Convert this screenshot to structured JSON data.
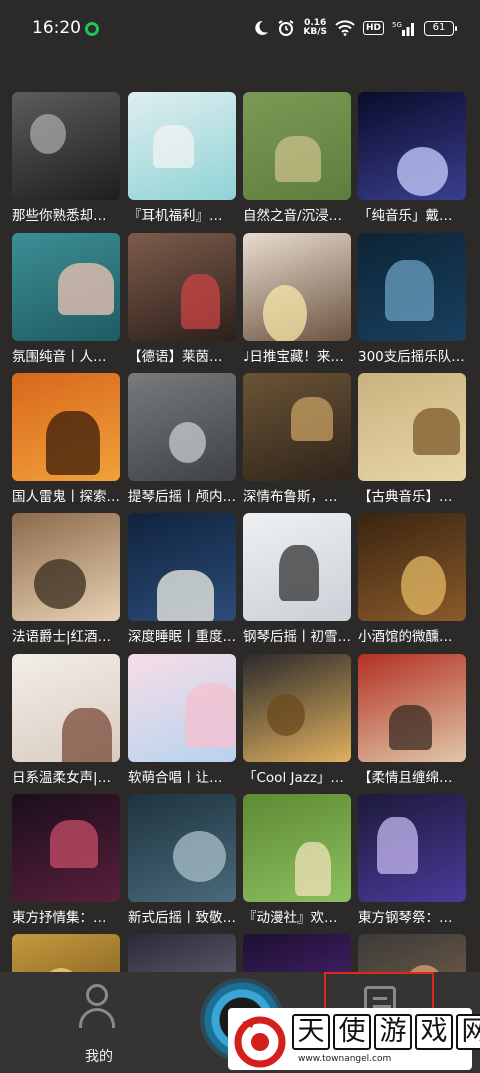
{
  "status_bar": {
    "time": "16:20",
    "net_speed_value": "0.16",
    "net_speed_unit": "KB/S",
    "hd_badge": "HD",
    "signal_label": "5G",
    "battery_level": "61"
  },
  "playlists": [
    {
      "title": "那些你熟悉却…"
    },
    {
      "title": "『耳机福利』…"
    },
    {
      "title": "自然之音/沉浸…"
    },
    {
      "title": "「纯音乐」戴…"
    },
    {
      "title": "氛围纯音丨人…"
    },
    {
      "title": "【德语】莱茵…"
    },
    {
      "title": "♩日推宝藏！来…"
    },
    {
      "title": "300支后摇乐队…"
    },
    {
      "title": "国人雷鬼丨探索…"
    },
    {
      "title": "提琴后摇丨颅内…"
    },
    {
      "title": "深情布鲁斯，…"
    },
    {
      "title": "【古典音乐】…"
    },
    {
      "title": "法语爵士|红酒…"
    },
    {
      "title": "深度睡眠丨重度…"
    },
    {
      "title": "钢琴后摇丨初雪…"
    },
    {
      "title": "小酒馆的微醺…"
    },
    {
      "title": "日系温柔女声|…"
    },
    {
      "title": "软萌合唱丨让…"
    },
    {
      "title": "「Cool Jazz」…"
    },
    {
      "title": "【柔情且缠绵…"
    },
    {
      "title": "東方抒情集：…"
    },
    {
      "title": "新式后摇丨致敬…"
    },
    {
      "title": "『动漫社』欢…"
    },
    {
      "title": "東方钢琴祭：…"
    },
    {
      "title": ""
    },
    {
      "title": ""
    },
    {
      "title": ""
    },
    {
      "title": ""
    }
  ],
  "bottom_nav": {
    "mine_label": "我的"
  },
  "watermark": {
    "chars": [
      "天",
      "使",
      "游",
      "戏",
      "网"
    ],
    "url": "www.townangel.com"
  },
  "colors": {
    "background": "#2b2a29",
    "nav_background": "#353433",
    "accent_blue": "#3aa6d8",
    "highlight_red": "#e0271d",
    "status_dot_green": "#1fc45a"
  }
}
